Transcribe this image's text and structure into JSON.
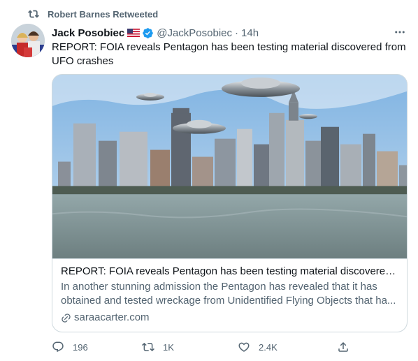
{
  "retweet": {
    "text": "Robert Barnes Retweeted",
    "icon": "retweet-icon"
  },
  "author": {
    "name": "Jack Posobiec",
    "flag_icon": "us-flag-icon",
    "verified_icon": "verified-badge-icon",
    "handle": "@JackPosobiec",
    "separator": "·",
    "time": "14h"
  },
  "more_icon": "more-options-icon",
  "tweet": {
    "text": "REPORT: FOIA reveals Pentagon has been testing material discovered from UFO crashes"
  },
  "card": {
    "title": "REPORT: FOIA reveals Pentagon has been testing material discovered fr...",
    "description": "In another stunning admission the Pentagon has revealed that it has obtained and tested wreckage from Unidentified Flying Objects that ha...",
    "domain": "saraacarter.com",
    "link_icon": "link-icon"
  },
  "actions": {
    "reply_count": "196",
    "retweet_count": "1K",
    "like_count": "2.4K"
  },
  "colors": {
    "accent": "#1d9bf0",
    "secondary_text": "#536471",
    "border": "#cfd9de"
  }
}
